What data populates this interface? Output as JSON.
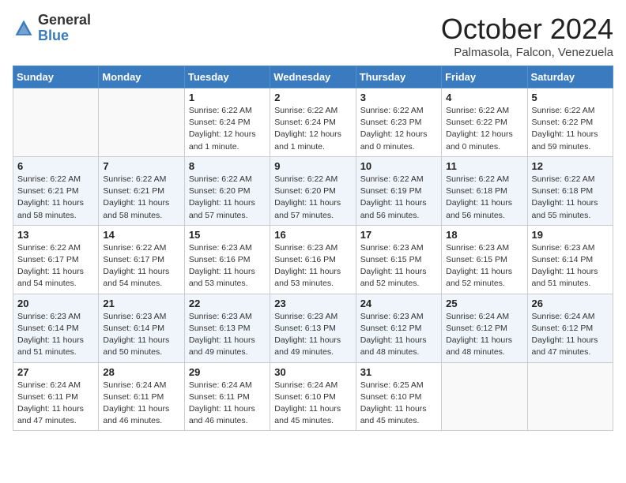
{
  "header": {
    "logo_general": "General",
    "logo_blue": "Blue",
    "month_title": "October 2024",
    "location": "Palmasola, Falcon, Venezuela"
  },
  "weekdays": [
    "Sunday",
    "Monday",
    "Tuesday",
    "Wednesday",
    "Thursday",
    "Friday",
    "Saturday"
  ],
  "weeks": [
    [
      {
        "day": "",
        "sunrise": "",
        "sunset": "",
        "daylight": ""
      },
      {
        "day": "",
        "sunrise": "",
        "sunset": "",
        "daylight": ""
      },
      {
        "day": "1",
        "sunrise": "Sunrise: 6:22 AM",
        "sunset": "Sunset: 6:24 PM",
        "daylight": "Daylight: 12 hours and 1 minute."
      },
      {
        "day": "2",
        "sunrise": "Sunrise: 6:22 AM",
        "sunset": "Sunset: 6:24 PM",
        "daylight": "Daylight: 12 hours and 1 minute."
      },
      {
        "day": "3",
        "sunrise": "Sunrise: 6:22 AM",
        "sunset": "Sunset: 6:23 PM",
        "daylight": "Daylight: 12 hours and 0 minutes."
      },
      {
        "day": "4",
        "sunrise": "Sunrise: 6:22 AM",
        "sunset": "Sunset: 6:22 PM",
        "daylight": "Daylight: 12 hours and 0 minutes."
      },
      {
        "day": "5",
        "sunrise": "Sunrise: 6:22 AM",
        "sunset": "Sunset: 6:22 PM",
        "daylight": "Daylight: 11 hours and 59 minutes."
      }
    ],
    [
      {
        "day": "6",
        "sunrise": "Sunrise: 6:22 AM",
        "sunset": "Sunset: 6:21 PM",
        "daylight": "Daylight: 11 hours and 58 minutes."
      },
      {
        "day": "7",
        "sunrise": "Sunrise: 6:22 AM",
        "sunset": "Sunset: 6:21 PM",
        "daylight": "Daylight: 11 hours and 58 minutes."
      },
      {
        "day": "8",
        "sunrise": "Sunrise: 6:22 AM",
        "sunset": "Sunset: 6:20 PM",
        "daylight": "Daylight: 11 hours and 57 minutes."
      },
      {
        "day": "9",
        "sunrise": "Sunrise: 6:22 AM",
        "sunset": "Sunset: 6:20 PM",
        "daylight": "Daylight: 11 hours and 57 minutes."
      },
      {
        "day": "10",
        "sunrise": "Sunrise: 6:22 AM",
        "sunset": "Sunset: 6:19 PM",
        "daylight": "Daylight: 11 hours and 56 minutes."
      },
      {
        "day": "11",
        "sunrise": "Sunrise: 6:22 AM",
        "sunset": "Sunset: 6:18 PM",
        "daylight": "Daylight: 11 hours and 56 minutes."
      },
      {
        "day": "12",
        "sunrise": "Sunrise: 6:22 AM",
        "sunset": "Sunset: 6:18 PM",
        "daylight": "Daylight: 11 hours and 55 minutes."
      }
    ],
    [
      {
        "day": "13",
        "sunrise": "Sunrise: 6:22 AM",
        "sunset": "Sunset: 6:17 PM",
        "daylight": "Daylight: 11 hours and 54 minutes."
      },
      {
        "day": "14",
        "sunrise": "Sunrise: 6:22 AM",
        "sunset": "Sunset: 6:17 PM",
        "daylight": "Daylight: 11 hours and 54 minutes."
      },
      {
        "day": "15",
        "sunrise": "Sunrise: 6:23 AM",
        "sunset": "Sunset: 6:16 PM",
        "daylight": "Daylight: 11 hours and 53 minutes."
      },
      {
        "day": "16",
        "sunrise": "Sunrise: 6:23 AM",
        "sunset": "Sunset: 6:16 PM",
        "daylight": "Daylight: 11 hours and 53 minutes."
      },
      {
        "day": "17",
        "sunrise": "Sunrise: 6:23 AM",
        "sunset": "Sunset: 6:15 PM",
        "daylight": "Daylight: 11 hours and 52 minutes."
      },
      {
        "day": "18",
        "sunrise": "Sunrise: 6:23 AM",
        "sunset": "Sunset: 6:15 PM",
        "daylight": "Daylight: 11 hours and 52 minutes."
      },
      {
        "day": "19",
        "sunrise": "Sunrise: 6:23 AM",
        "sunset": "Sunset: 6:14 PM",
        "daylight": "Daylight: 11 hours and 51 minutes."
      }
    ],
    [
      {
        "day": "20",
        "sunrise": "Sunrise: 6:23 AM",
        "sunset": "Sunset: 6:14 PM",
        "daylight": "Daylight: 11 hours and 51 minutes."
      },
      {
        "day": "21",
        "sunrise": "Sunrise: 6:23 AM",
        "sunset": "Sunset: 6:14 PM",
        "daylight": "Daylight: 11 hours and 50 minutes."
      },
      {
        "day": "22",
        "sunrise": "Sunrise: 6:23 AM",
        "sunset": "Sunset: 6:13 PM",
        "daylight": "Daylight: 11 hours and 49 minutes."
      },
      {
        "day": "23",
        "sunrise": "Sunrise: 6:23 AM",
        "sunset": "Sunset: 6:13 PM",
        "daylight": "Daylight: 11 hours and 49 minutes."
      },
      {
        "day": "24",
        "sunrise": "Sunrise: 6:23 AM",
        "sunset": "Sunset: 6:12 PM",
        "daylight": "Daylight: 11 hours and 48 minutes."
      },
      {
        "day": "25",
        "sunrise": "Sunrise: 6:24 AM",
        "sunset": "Sunset: 6:12 PM",
        "daylight": "Daylight: 11 hours and 48 minutes."
      },
      {
        "day": "26",
        "sunrise": "Sunrise: 6:24 AM",
        "sunset": "Sunset: 6:12 PM",
        "daylight": "Daylight: 11 hours and 47 minutes."
      }
    ],
    [
      {
        "day": "27",
        "sunrise": "Sunrise: 6:24 AM",
        "sunset": "Sunset: 6:11 PM",
        "daylight": "Daylight: 11 hours and 47 minutes."
      },
      {
        "day": "28",
        "sunrise": "Sunrise: 6:24 AM",
        "sunset": "Sunset: 6:11 PM",
        "daylight": "Daylight: 11 hours and 46 minutes."
      },
      {
        "day": "29",
        "sunrise": "Sunrise: 6:24 AM",
        "sunset": "Sunset: 6:11 PM",
        "daylight": "Daylight: 11 hours and 46 minutes."
      },
      {
        "day": "30",
        "sunrise": "Sunrise: 6:24 AM",
        "sunset": "Sunset: 6:10 PM",
        "daylight": "Daylight: 11 hours and 45 minutes."
      },
      {
        "day": "31",
        "sunrise": "Sunrise: 6:25 AM",
        "sunset": "Sunset: 6:10 PM",
        "daylight": "Daylight: 11 hours and 45 minutes."
      },
      {
        "day": "",
        "sunrise": "",
        "sunset": "",
        "daylight": ""
      },
      {
        "day": "",
        "sunrise": "",
        "sunset": "",
        "daylight": ""
      }
    ]
  ]
}
